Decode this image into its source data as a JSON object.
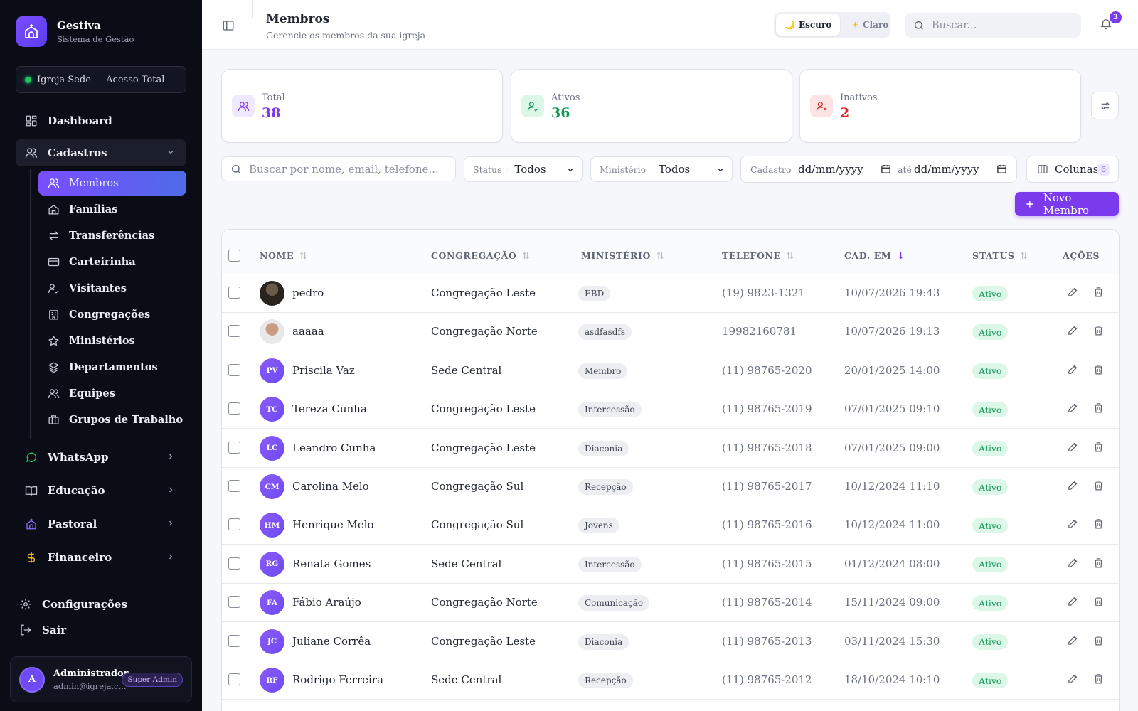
{
  "brand": {
    "name": "Gestiva",
    "subtitle": "Sistema de Gestão"
  },
  "scope": "Igreja Sede — Acesso Total",
  "nav": {
    "dashboard": "Dashboard",
    "cadastros": "Cadastros",
    "sub": [
      "Membros",
      "Famílias",
      "Transferências",
      "Carteirinha",
      "Visitantes",
      "Congregações",
      "Ministérios",
      "Departamentos",
      "Equipes",
      "Grupos de Trabalho"
    ],
    "whatsapp": "WhatsApp",
    "educacao": "Educação",
    "pastoral": "Pastoral",
    "financeiro": "Financeiro",
    "config": "Configurações",
    "sair": "Sair"
  },
  "user": {
    "initial": "A",
    "name": "Administrador",
    "email": "admin@igreja.c...",
    "role": "Super Admin"
  },
  "header": {
    "title": "Membros",
    "subtitle": "Gerencie os membros da sua igreja",
    "theme_dark": "Escuro",
    "theme_light": "Claro",
    "search_placeholder": "Buscar...",
    "notifications": "3"
  },
  "stats": {
    "total": {
      "label": "Total",
      "value": "38",
      "color": "#7c3aed"
    },
    "ativos": {
      "label": "Ativos",
      "value": "36",
      "color": "#15975a"
    },
    "inativos": {
      "label": "Inativos",
      "value": "2",
      "color": "#dc2626"
    }
  },
  "filters": {
    "search_placeholder": "Buscar por nome, email, telefone...",
    "status_label": "Status",
    "status_value": "Todos",
    "ministerio_label": "Ministério",
    "ministerio_value": "Todos",
    "cadastro_label": "Cadastro",
    "date_from": "dd/mm/yyyy",
    "ate": "até",
    "date_to": "dd/mm/yyyy",
    "columns_label": "Colunas",
    "columns_count": "6",
    "new_member": "Novo Membro"
  },
  "table": {
    "headers": {
      "nome": "NOME",
      "congregacao": "CONGREGAÇÃO",
      "ministerio": "MINISTÉRIO",
      "telefone": "TELEFONE",
      "cadastro": "CAD. EM",
      "status": "STATUS",
      "acoes": "AÇÕES"
    },
    "rows": [
      {
        "initials": "",
        "photo": "photo-1",
        "nome": "pedro",
        "congregacao": "Congregação Leste",
        "ministerio": "EBD",
        "telefone": "(19) 9823-1321",
        "cadastro": "10/07/2026 19:43",
        "status": "Ativo"
      },
      {
        "initials": "",
        "photo": "photo-2",
        "nome": "aaaaa",
        "congregacao": "Congregação Norte",
        "ministerio": "asdfasdfs",
        "telefone": "19982160781",
        "cadastro": "10/07/2026 19:13",
        "status": "Ativo"
      },
      {
        "initials": "PV",
        "nome": "Priscila Vaz",
        "congregacao": "Sede Central",
        "ministerio": "Membro",
        "telefone": "(11) 98765-2020",
        "cadastro": "20/01/2025 14:00",
        "status": "Ativo"
      },
      {
        "initials": "TC",
        "nome": "Tereza Cunha",
        "congregacao": "Congregação Leste",
        "ministerio": "Intercessão",
        "telefone": "(11) 98765-2019",
        "cadastro": "07/01/2025 09:10",
        "status": "Ativo"
      },
      {
        "initials": "LC",
        "nome": "Leandro Cunha",
        "congregacao": "Congregação Leste",
        "ministerio": "Diaconia",
        "telefone": "(11) 98765-2018",
        "cadastro": "07/01/2025 09:00",
        "status": "Ativo"
      },
      {
        "initials": "CM",
        "nome": "Carolina Melo",
        "congregacao": "Congregação Sul",
        "ministerio": "Recepção",
        "telefone": "(11) 98765-2017",
        "cadastro": "10/12/2024 11:10",
        "status": "Ativo"
      },
      {
        "initials": "HM",
        "nome": "Henrique Melo",
        "congregacao": "Congregação Sul",
        "ministerio": "Jovens",
        "telefone": "(11) 98765-2016",
        "cadastro": "10/12/2024 11:00",
        "status": "Ativo"
      },
      {
        "initials": "RG",
        "nome": "Renata Gomes",
        "congregacao": "Sede Central",
        "ministerio": "Intercessão",
        "telefone": "(11) 98765-2015",
        "cadastro": "01/12/2024 08:00",
        "status": "Ativo"
      },
      {
        "initials": "FA",
        "nome": "Fábio Araújo",
        "congregacao": "Congregação Norte",
        "ministerio": "Comunicação",
        "telefone": "(11) 98765-2014",
        "cadastro": "15/11/2024 09:00",
        "status": "Ativo"
      },
      {
        "initials": "JC",
        "nome": "Juliane Corrêa",
        "congregacao": "Congregação Leste",
        "ministerio": "Diaconia",
        "telefone": "(11) 98765-2013",
        "cadastro": "03/11/2024 15:30",
        "status": "Ativo"
      },
      {
        "initials": "RF",
        "nome": "Rodrigo Ferreira",
        "congregacao": "Sede Central",
        "ministerio": "Recepção",
        "telefone": "(11) 98765-2012",
        "cadastro": "18/10/2024 10:10",
        "status": "Ativo"
      }
    ]
  }
}
